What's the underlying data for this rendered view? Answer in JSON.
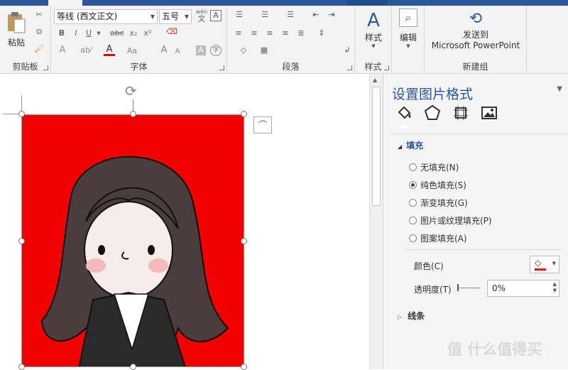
{
  "ribbon": {
    "clipboard": {
      "paste": "粘贴",
      "label": "剪贴板"
    },
    "font": {
      "name": "等线 (西文正文)",
      "size": "五号",
      "wen": "wén",
      "wen_char": "文",
      "a_box": "A",
      "bold": "B",
      "italic": "I",
      "underline": "U",
      "strike": "abc",
      "sub": "x₂",
      "sup": "x²",
      "font_color": "A",
      "aa": "Aa",
      "grow": "A",
      "shrink": "A",
      "char_shade": "A",
      "enclose": "字",
      "label": "字体"
    },
    "paragraph": {
      "label": "段落"
    },
    "styles": {
      "styles": "样式",
      "label": "样式"
    },
    "edit": {
      "edit": "编辑"
    },
    "new_group": {
      "line1": "发送到",
      "line2": "Microsoft PowerPoint",
      "label": "新建组"
    }
  },
  "pane": {
    "title": "设置图片格式",
    "fill_section": "填充",
    "options": [
      {
        "label": "无填充(N)",
        "selected": false
      },
      {
        "label": "纯色填充(S)",
        "selected": true
      },
      {
        "label": "渐变填充(G)",
        "selected": false
      },
      {
        "label": "图片或纹理填充(P)",
        "selected": false
      },
      {
        "label": "图案填充(A)",
        "selected": false
      }
    ],
    "color_label": "颜色(C)",
    "transparency_label": "透明度(T)",
    "transparency_value": "0%",
    "line_section": "线条"
  },
  "colors": {
    "accent": "#2b579a",
    "image_bg": "#f20000"
  },
  "watermark": "值 什么值得买"
}
